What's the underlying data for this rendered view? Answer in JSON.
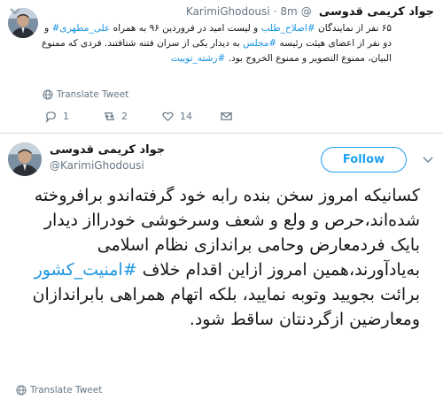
{
  "tweet1": {
    "author_name": "جواد کریمی قدوسی",
    "handle": "@KarimiGhodousi",
    "time": "· 8m",
    "text_parts": [
      {
        "text": "۶۵ نفر از نمایندگان ",
        "link": false
      },
      {
        "text": "#اصلاح_طلب",
        "link": true
      },
      {
        "text": " و لیست امید در فروردین ۹۶ به همراه ",
        "link": false
      },
      {
        "text": "علی_مطهری#",
        "link": true
      },
      {
        "text": " و دو نفر از اعضای هیئت رئیسه ",
        "link": false
      },
      {
        "text": "#مجلس",
        "link": true
      },
      {
        "text": " به دیدار یکی از سران فتنه شتافتند. فردی که ممنوع البیان، ممنوع التصویر و ممنوع الخروج بود. ",
        "link": false
      },
      {
        "text": "#رشته_توییت",
        "link": true
      }
    ],
    "translate_label": "Translate Tweet",
    "reply_count": "1",
    "retweet_count": "2",
    "like_count": "14"
  },
  "tweet2": {
    "author_name": "جواد کریمی قدوسی",
    "handle": "@KarimiGhodousi",
    "follow_label": "Follow",
    "text_parts": [
      {
        "text": "کسانیکه امروز سخن بنده رابه خود گرفته‌اندو برافروخته شده‌اند،حرص و ولع و شعف وسرخوشی خودرااز دیدار بایک فردمعارض وحامی براندازی نظام اسلامی به‌یادآورند،همین امروز ازاین اقدام خلاف ",
        "link": false
      },
      {
        "text": "#امنیت_کشور",
        "link": true
      },
      {
        "text": " برائت بجویید وتوبه نمایید، بلکه اتهام همراهی بابراندازان ومعارضین ازگردنتان ساقط شود.",
        "link": false
      }
    ],
    "translate_label": "Translate Tweet"
  },
  "colors": {
    "link": "#1b95e0",
    "follow_border": "#1da1f2",
    "meta_text": "#657786"
  }
}
